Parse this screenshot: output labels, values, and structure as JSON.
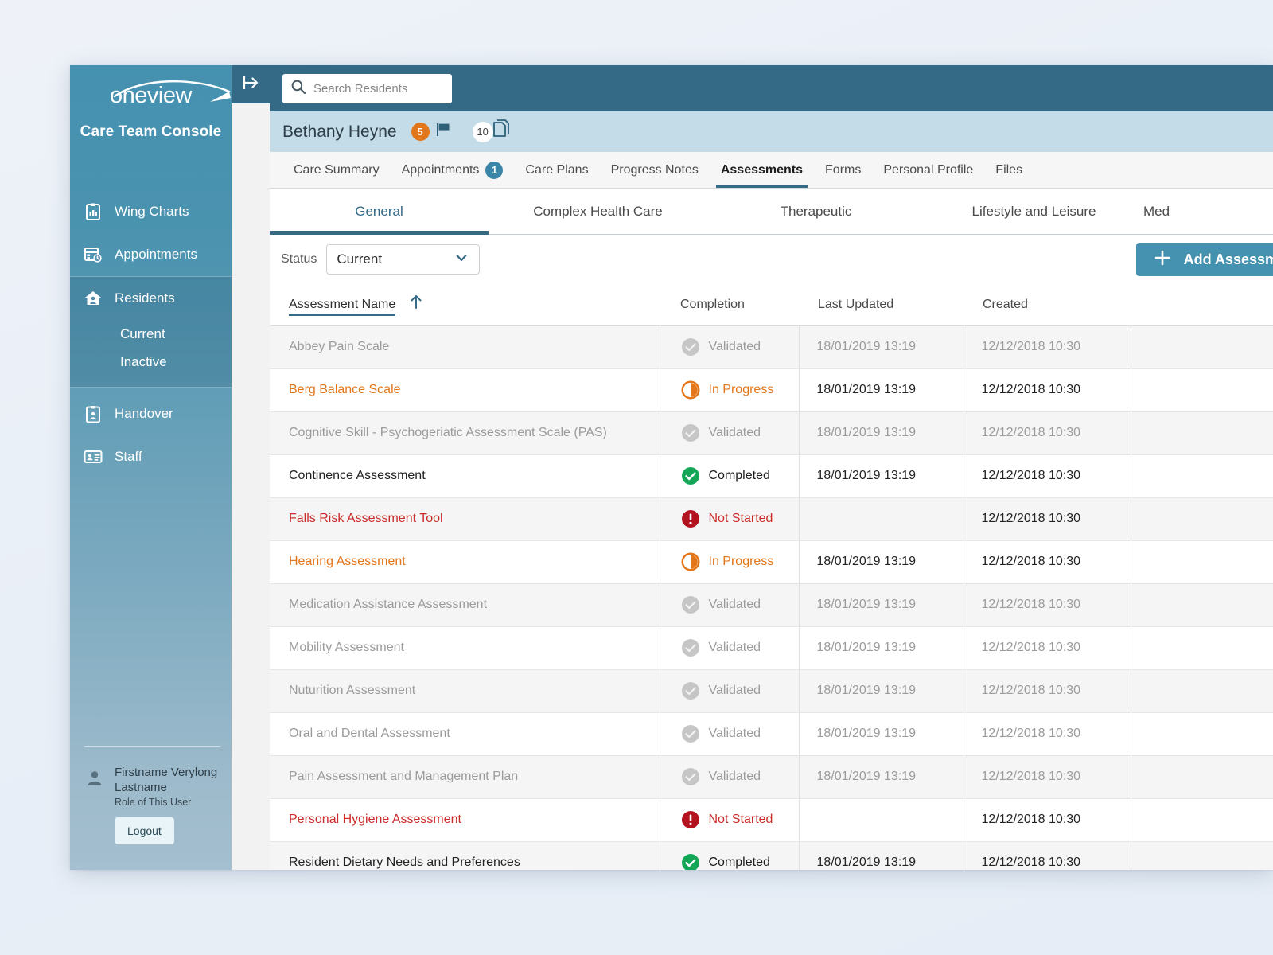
{
  "brand": {
    "logo_text": "oneview",
    "console_title": "Care Team Console"
  },
  "sidebar": {
    "items": [
      {
        "label": "Wing Charts",
        "icon": "wing-charts-icon"
      },
      {
        "label": "Appointments",
        "icon": "appointments-icon"
      },
      {
        "label": "Residents",
        "icon": "residents-home-icon"
      },
      {
        "label": "Handover",
        "icon": "handover-clipboard-icon"
      },
      {
        "label": "Staff",
        "icon": "staff-badge-icon"
      }
    ],
    "residents_sub": [
      {
        "label": "Current"
      },
      {
        "label": "Inactive"
      }
    ],
    "user": {
      "name": "Firstname Verylong Lastname",
      "role": "Role of This User",
      "logout_label": "Logout",
      "avatar_icon": "person-icon"
    }
  },
  "rail": {
    "collapse_icon": "collapse-panel-icon"
  },
  "search": {
    "placeholder": "Search Residents",
    "value": "",
    "icon": "search-icon"
  },
  "resident": {
    "name": "Bethany Heyne",
    "flag_count": "5",
    "flag_icon": "flag-icon",
    "docs_count": "10",
    "docs_icon": "documents-icon"
  },
  "tabs": [
    {
      "label": "Care Summary",
      "badge": null,
      "active": false
    },
    {
      "label": "Appointments",
      "badge": "1",
      "active": false
    },
    {
      "label": "Care Plans",
      "badge": null,
      "active": false
    },
    {
      "label": "Progress Notes",
      "badge": null,
      "active": false
    },
    {
      "label": "Assessments",
      "badge": null,
      "active": true
    },
    {
      "label": "Forms",
      "badge": null,
      "active": false
    },
    {
      "label": "Personal Profile",
      "badge": null,
      "active": false
    },
    {
      "label": "Files",
      "badge": null,
      "active": false
    }
  ],
  "subtabs": [
    {
      "label": "General",
      "active": true
    },
    {
      "label": "Complex Health Care",
      "active": false
    },
    {
      "label": "Therapeutic",
      "active": false
    },
    {
      "label": "Lifestyle and Leisure",
      "active": false
    },
    {
      "label": "Med",
      "active": false
    }
  ],
  "filter": {
    "status_label": "Status",
    "status_value": "Current",
    "chevron_icon": "chevron-down-icon"
  },
  "add_button": {
    "label": "Add Assessment",
    "icon": "plus-icon"
  },
  "table": {
    "columns": [
      {
        "key": "name",
        "label": "Assessment Name",
        "sorted": true,
        "sort_icon": "sort-ascending-arrow-icon"
      },
      {
        "key": "completion",
        "label": "Completion",
        "sorted": false
      },
      {
        "key": "last_updated",
        "label": "Last Updated",
        "sorted": false
      },
      {
        "key": "created",
        "label": "Created",
        "sorted": false
      },
      {
        "key": "extra",
        "label": "",
        "sorted": false
      }
    ],
    "rows": [
      {
        "name": "Abbey Pain Scale",
        "status": "Validated",
        "status_key": "validated",
        "last_updated": "18/01/2019 13:19",
        "created": "12/12/2018 10:30"
      },
      {
        "name": "Berg Balance Scale",
        "status": "In Progress",
        "status_key": "inprogress",
        "last_updated": "18/01/2019 13:19",
        "created": "12/12/2018 10:30"
      },
      {
        "name": "Cognitive Skill - Psychogeriatic Assessment Scale (PAS)",
        "status": "Validated",
        "status_key": "validated",
        "last_updated": "18/01/2019 13:19",
        "created": "12/12/2018 10:30"
      },
      {
        "name": "Continence Assessment",
        "status": "Completed",
        "status_key": "completed",
        "last_updated": "18/01/2019 13:19",
        "created": "12/12/2018 10:30"
      },
      {
        "name": "Falls Risk Assessment Tool",
        "status": "Not Started",
        "status_key": "notstarted",
        "last_updated": "",
        "created": "12/12/2018 10:30"
      },
      {
        "name": "Hearing Assessment",
        "status": "In Progress",
        "status_key": "inprogress",
        "last_updated": "18/01/2019 13:19",
        "created": "12/12/2018 10:30"
      },
      {
        "name": "Medication Assistance Assessment",
        "status": "Validated",
        "status_key": "validated",
        "last_updated": "18/01/2019 13:19",
        "created": "12/12/2018 10:30"
      },
      {
        "name": "Mobility Assessment",
        "status": "Validated",
        "status_key": "validated",
        "last_updated": "18/01/2019 13:19",
        "created": "12/12/2018 10:30"
      },
      {
        "name": "Nuturition Assessment",
        "status": "Validated",
        "status_key": "validated",
        "last_updated": "18/01/2019 13:19",
        "created": "12/12/2018 10:30"
      },
      {
        "name": "Oral and Dental Assessment",
        "status": "Validated",
        "status_key": "validated",
        "last_updated": "18/01/2019 13:19",
        "created": "12/12/2018 10:30"
      },
      {
        "name": "Pain Assessment and Management Plan",
        "status": "Validated",
        "status_key": "validated",
        "last_updated": "18/01/2019 13:19",
        "created": "12/12/2018 10:30"
      },
      {
        "name": "Personal Hygiene Assessment",
        "status": "Not Started",
        "status_key": "notstarted",
        "last_updated": "",
        "created": "12/12/2018 10:30"
      },
      {
        "name": "Resident Dietary Needs and Preferences",
        "status": "Completed",
        "status_key": "completed",
        "last_updated": "18/01/2019 13:19",
        "created": "12/12/2018 10:30"
      }
    ]
  },
  "colors": {
    "sidebar_top": "#4591b0",
    "sidebar_bottom": "#a4bfcf",
    "topbar": "#356a87",
    "resident_bar": "#c3dce8",
    "accent": "#356a87",
    "button_blue": "#4591b0",
    "status_inprogress": "#e2761b",
    "status_notstarted": "#cc2b2b",
    "status_completed": "#12a656",
    "status_validated": "#c6c6c6",
    "flag_badge": "#e2761b",
    "tab_badge": "#3b85a8"
  }
}
